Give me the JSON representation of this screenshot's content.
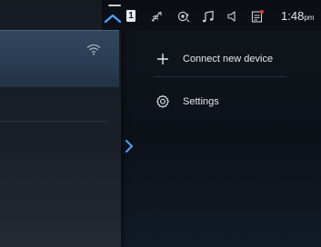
{
  "status_bar": {
    "profile_badge": "1",
    "time": "1:48",
    "ampm": "pm",
    "icons": [
      "pull-tab-icon",
      "wireless-charging-icon",
      "voice-assistant-icon",
      "music-note-icon",
      "speaker-muted-icon",
      "notification-icon"
    ],
    "notification_dot_color": "#e33434"
  },
  "left_panel": {
    "wifi_icon": "wifi-icon"
  },
  "menu": {
    "items": [
      {
        "label": "Connect new device",
        "icon": "plus-icon"
      },
      {
        "label": "Settings",
        "icon": "gear-icon"
      }
    ]
  },
  "colors": {
    "accent": "#4aa3ff",
    "header_card": "#2a3d54"
  }
}
